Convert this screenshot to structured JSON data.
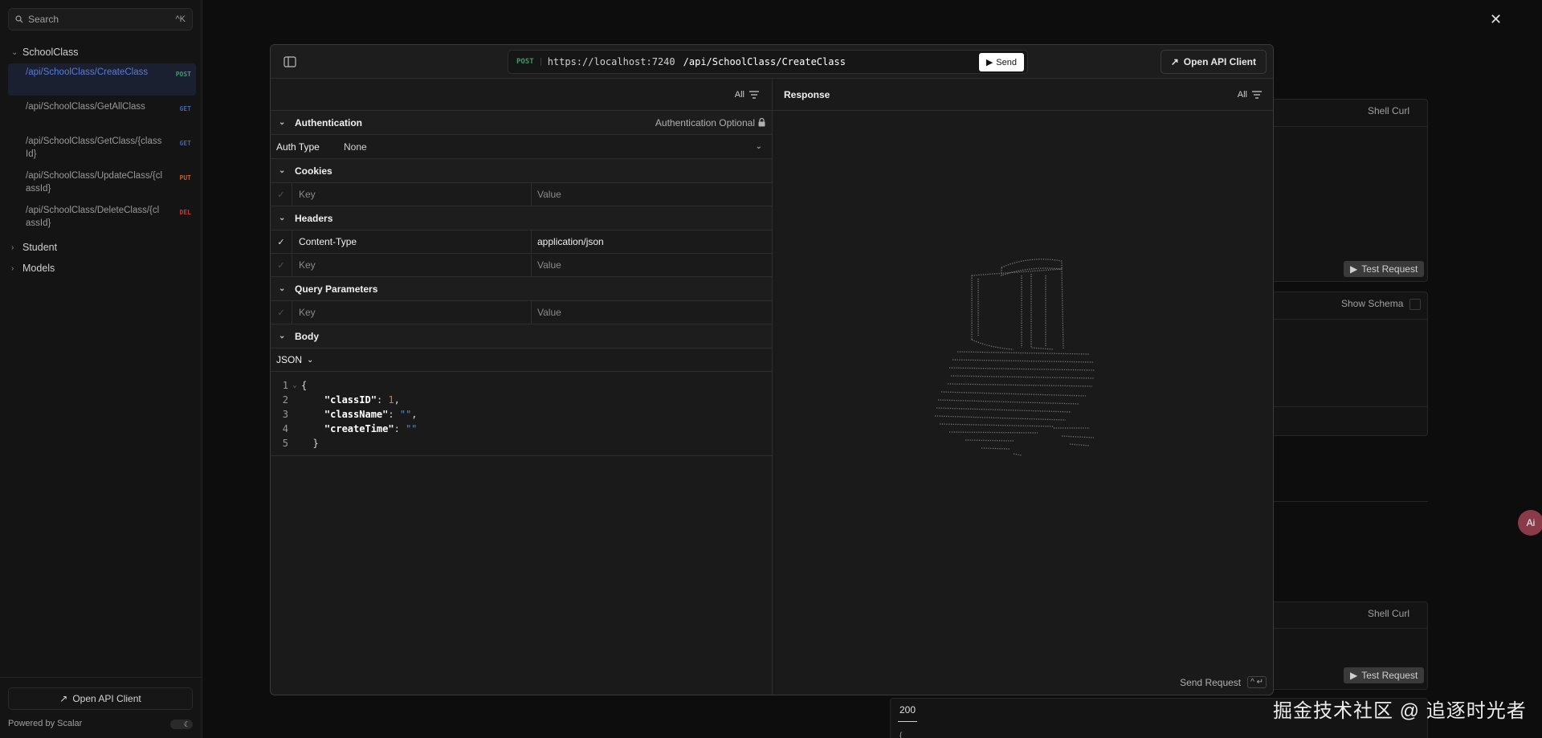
{
  "sidebar": {
    "search": {
      "label": "Search",
      "shortcut": "^K"
    },
    "groups": [
      {
        "label": "SchoolClass",
        "expanded": true
      },
      {
        "label": "Student",
        "expanded": false
      },
      {
        "label": "Models",
        "expanded": false
      }
    ],
    "operations": [
      {
        "path": "/api/SchoolClass/CreateClass",
        "method": "POST",
        "active": true
      },
      {
        "path": "/api/SchoolClass/GetAllClass",
        "method": "GET"
      },
      {
        "path": "/api/SchoolClass/GetClass/{classId}",
        "method": "GET"
      },
      {
        "path": "/api/SchoolClass/UpdateClass/{classId}",
        "method": "PUT"
      },
      {
        "path": "/api/SchoolClass/DeleteClass/{classId}",
        "method": "DEL"
      }
    ],
    "open_client_label": "Open API Client",
    "powered_by": "Powered by Scalar"
  },
  "background": {
    "shell_curl_1": "Shell Curl",
    "test_request_1": "Test Request",
    "show_schema": "Show Schema",
    "shell_curl_2": "Shell Curl",
    "test_request_2": "Test Request",
    "status_200": "200",
    "brace": "{"
  },
  "modal": {
    "address": {
      "method": "POST",
      "host": "https://localhost:7240",
      "path": "/api/SchoolClass/CreateClass",
      "send_label": "Send"
    },
    "open_client_label": "Open API Client",
    "filter_label": "All",
    "sections": {
      "authentication": {
        "title": "Authentication",
        "note": "Authentication Optional"
      },
      "auth_type": {
        "label": "Auth Type",
        "value": "None"
      },
      "cookies": {
        "title": "Cookies",
        "key_placeholder": "Key",
        "value_placeholder": "Value"
      },
      "headers": {
        "title": "Headers",
        "rows": [
          {
            "key": "Content-Type",
            "value": "application/json",
            "enabled": true
          }
        ],
        "key_placeholder": "Key",
        "value_placeholder": "Value"
      },
      "query": {
        "title": "Query Parameters",
        "key_placeholder": "Key",
        "value_placeholder": "Value"
      },
      "body": {
        "title": "Body",
        "format": "JSON"
      }
    },
    "code_lines": [
      {
        "n": "1",
        "text": "{"
      },
      {
        "n": "2",
        "key": "\"classID\"",
        "val": "1",
        "type": "num",
        "tail": ","
      },
      {
        "n": "3",
        "key": "\"className\"",
        "val": "\"\"",
        "type": "str",
        "tail": ","
      },
      {
        "n": "4",
        "key": "\"createTime\"",
        "val": "\"\"",
        "type": "str",
        "tail": ""
      },
      {
        "n": "5",
        "text": "}"
      }
    ],
    "response": {
      "title": "Response",
      "filter_label": "All",
      "send_request_label": "Send Request",
      "shortcut": "^ ↵"
    }
  },
  "watermark": "掘金技术社区 @ 追逐时光者",
  "fab_label": "Ai",
  "colors": {
    "post": "#3f9a6d",
    "get": "#3d63b8",
    "put": "#c65a23",
    "delete": "#c33a3a",
    "active_link": "#5a7bd8"
  }
}
